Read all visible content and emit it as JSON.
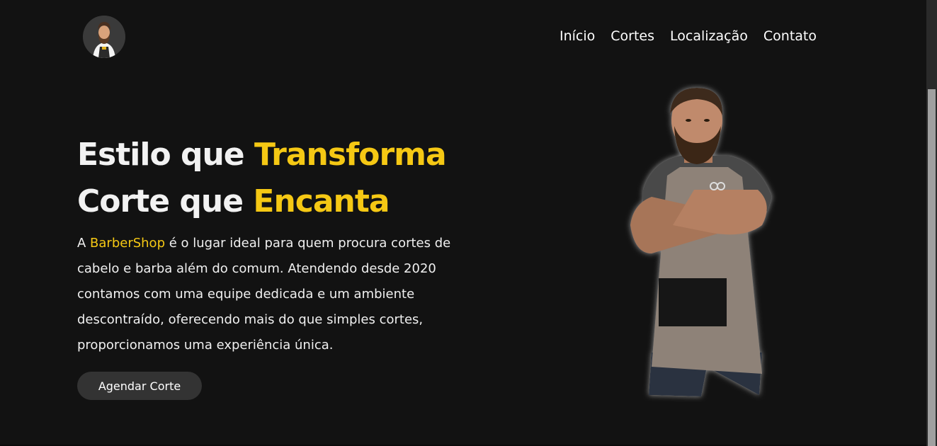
{
  "header": {
    "logo_icon": "barber-avatar-icon",
    "nav": [
      {
        "label": "Início"
      },
      {
        "label": "Cortes"
      },
      {
        "label": "Localização"
      },
      {
        "label": "Contato"
      }
    ]
  },
  "hero": {
    "title_line1_part1": "Estilo que ",
    "title_line1_accent": "Transforma",
    "title_line2_part1": "Corte que ",
    "title_line2_accent": "Encanta",
    "text_prefix": "A ",
    "text_brand": "BarberShop",
    "text_rest": " é o lugar ideal para quem procura cortes de cabelo e barba além do comum. Atendendo desde 2020 contamos com uma equipe dedicada e um ambiente descontraído, oferecendo mais do que simples cortes, proporcionamos uma experiência única.",
    "cta_label": "Agendar Corte",
    "image_icon": "barber-portrait-icon"
  },
  "colors": {
    "background": "#121212",
    "accent": "#f5c814",
    "button": "#333333",
    "text": "#ffffff"
  }
}
